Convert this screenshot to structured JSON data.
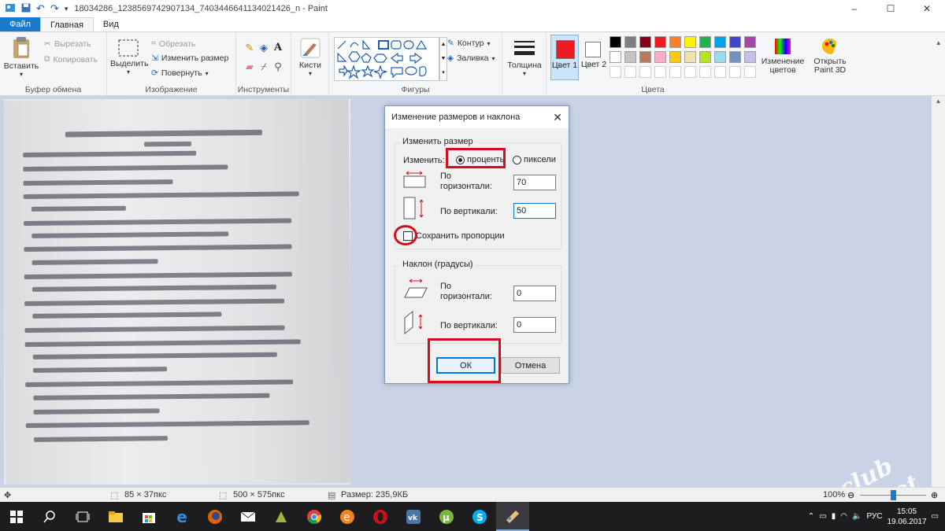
{
  "window": {
    "title": "18034286_1238569742907134_7403446641134021426_n - Paint",
    "controls": [
      "–",
      "☐",
      "✕"
    ]
  },
  "tabs": [
    {
      "label": "Файл"
    },
    {
      "label": "Главная"
    },
    {
      "label": "Вид"
    }
  ],
  "ribbon": {
    "clipboard": {
      "paste": "Вставить",
      "cut": "Вырезать",
      "copy": "Копировать",
      "group": "Буфер обмена"
    },
    "image": {
      "select": "Выделить",
      "crop": "Обрезать",
      "resize": "Изменить размер",
      "rotate": "Повернуть",
      "group": "Изображение"
    },
    "tools": {
      "group": "Инструменты"
    },
    "brushes": {
      "label": "Кисти"
    },
    "shapes": {
      "outline": "Контур",
      "fill": "Заливка",
      "group": "Фигуры"
    },
    "size": {
      "label": "Толщина"
    },
    "colors": {
      "color1": "Цвет 1",
      "color2": "Цвет 2",
      "edit": "Изменение цветов",
      "paint3d": "Открыть Paint 3D",
      "group": "Цвета",
      "color1_value": "#ed1c24",
      "color2_value": "#ffffff",
      "palette": [
        "#000000",
        "#7f7f7f",
        "#880015",
        "#ed1c24",
        "#ff7f27",
        "#fff200",
        "#22b14c",
        "#00a2e8",
        "#3f48cc",
        "#a349a4",
        "#ffffff",
        "#c3c3c3",
        "#b97a57",
        "#ffaec9",
        "#ffc90e",
        "#efe4b0",
        "#b5e61d",
        "#99d9ea",
        "#7092be",
        "#c8bfe7"
      ]
    }
  },
  "dialog": {
    "title": "Изменение размеров и наклона",
    "resize_group": "Изменить размер",
    "by_label": "Изменить:",
    "percent_label": "проценты",
    "pixels_label": "пиксели",
    "horizontal_label": "По горизонтали:",
    "vertical_label": "По вертикали:",
    "resize_h_value": "70",
    "resize_v_value": "50",
    "keep_ratio_label": "Сохранить пропорции",
    "skew_group": "Наклон (градусы)",
    "skew_h_value": "0",
    "skew_v_value": "0",
    "ok": "ОК",
    "cancel": "Отмена"
  },
  "status": {
    "selection": "85 × 37пкс",
    "image_size": "500 × 575пкс",
    "file_size": "Размер: 235,9КБ",
    "zoom": "100%"
  },
  "taskbar": {
    "lang": "РУС",
    "time": "15:05",
    "date": "19.06.2017"
  },
  "watermark": "club Sovet"
}
